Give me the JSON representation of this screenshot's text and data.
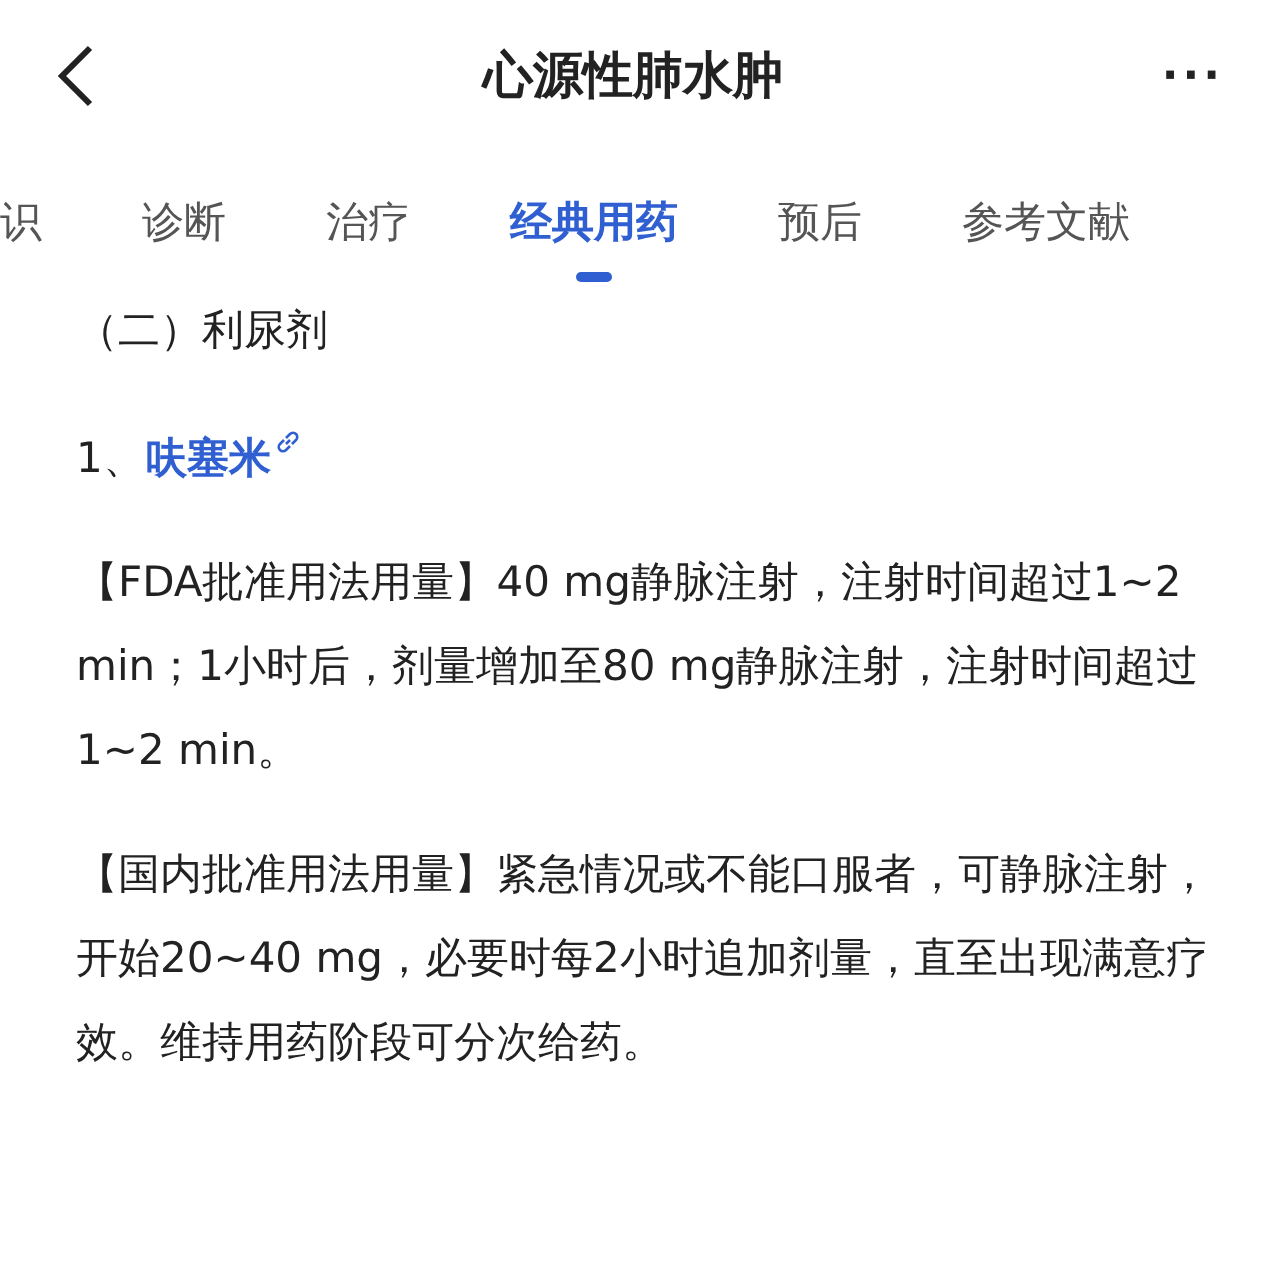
{
  "header": {
    "title": "心源性肺水肿",
    "more": "···"
  },
  "tabs": [
    {
      "label": "识",
      "selected": false
    },
    {
      "label": "诊断",
      "selected": false
    },
    {
      "label": "治疗",
      "selected": false
    },
    {
      "label": "经典用药",
      "selected": true
    },
    {
      "label": "预后",
      "selected": false
    },
    {
      "label": "参考文献",
      "selected": false
    }
  ],
  "content": {
    "section_heading": "（二）利尿剂",
    "drug": {
      "number": "1、",
      "name": "呋塞米"
    },
    "paragraphs": [
      "【FDA批准用法用量】40 mg静脉注射，注射时间超过1~2 min；1小时后，剂量增加至80 mg静脉注射，注射时间超过1~2 min。",
      "【国内批准用法用量】紧急情况或不能口服者，可静脉注射，开始20~40 mg，必要时每2小时追加剂量，直至出现满意疗效。维持用药阶段可分次给药。"
    ]
  }
}
